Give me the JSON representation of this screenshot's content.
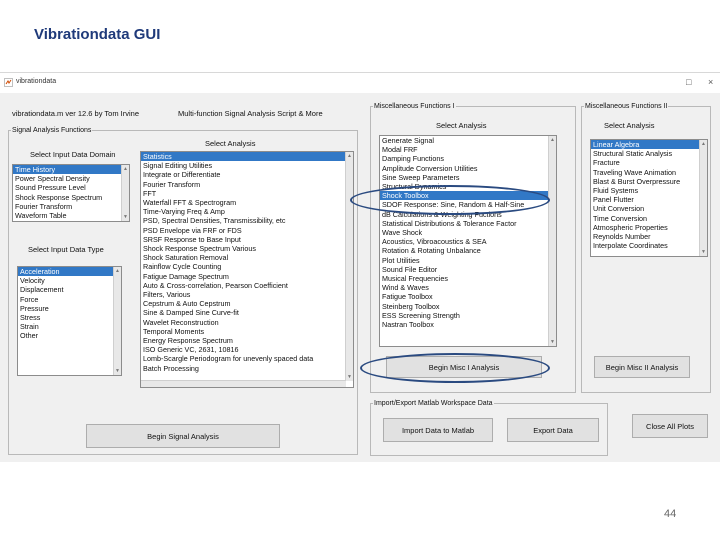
{
  "slide": {
    "title": "Vibrationdata GUI",
    "page_number": "44"
  },
  "window": {
    "title": "vibrationdata",
    "maximize_glyph": "□",
    "close_glyph": "×"
  },
  "header": {
    "version": "vibrationdata.m   ver 12.6   by Tom Irvine",
    "subtitle": "Multi-function Signal Analysis Script & More"
  },
  "signal_panel": {
    "legend": "Signal Analysis Functions",
    "domain_label": "Select Input Data Domain",
    "domain_items": [
      "Time History",
      "Power Spectral Density",
      "Sound Pressure Level",
      "Shock Response Spectrum",
      "Fourier Transform",
      "Waveform Table"
    ],
    "type_label": "Select Input Data Type",
    "type_items": [
      "Acceleration",
      "Velocity",
      "Displacement",
      "Force",
      "Pressure",
      "Stress",
      "Strain",
      "Other"
    ],
    "analysis_label": "Select Analysis",
    "analysis_items": [
      "Statistics",
      "Signal Editing Utilities",
      "Integrate or Differentiate",
      "Fourier Transform",
      "FFT",
      "Waterfall FFT & Spectrogram",
      "Time-Varying Freq & Amp",
      "PSD, Spectral Densities, Transmissibility, etc",
      "PSD Envelope via FRF or FDS",
      "SRSF Response to Base Input",
      "Shock Response Spectrum Various",
      "Shock Saturation Removal",
      "Rainflow Cycle Counting",
      "Fatigue Damage Spectrum",
      "Auto & Cross-correlation, Pearson Coefficient",
      "Filters, Various",
      "Cepstrum & Auto Cepstrum",
      "Sine & Damped Sine Curve-fit",
      "Wavelet Reconstruction",
      "Temporal Moments",
      "Energy Response Spectrum",
      "ISO Generic VC, 2631, 10816",
      "Lomb-Scargle Periodogram for unevenly spaced data",
      "Batch Processing"
    ],
    "begin_button": "Begin Signal Analysis"
  },
  "misc1_panel": {
    "legend": "Miscellaneous Functions I",
    "select_label": "Select Analysis",
    "items": [
      "Generate Signal",
      "Modal FRF",
      "Damping Functions",
      "Amplitude Conversion Utilities",
      "Sine Sweep Parameters",
      "Structural Dynamics",
      "Shock Toolbox",
      "SDOF Response: Sine, Random & Half-Sine",
      "dB Calculations & Weighting Fuctions",
      "Statistical Distributions & Tolerance Factor",
      "Wave Shock",
      "Acoustics, Vibroacoustics & SEA",
      "Rotation & Rotating Unbalance",
      "Plot Utilities",
      "Sound File Editor",
      "Musical Frequencies",
      "Wind & Waves",
      "Fatigue Toolbox",
      "Steinberg Toolbox",
      "ESS Screening Strength",
      "Nastran Toolbox"
    ],
    "selected_index": 6,
    "begin_button": "Begin Misc I Analysis"
  },
  "misc2_panel": {
    "legend": "Miscellaneous Functions II",
    "select_label": "Select Analysis",
    "items": [
      "Linear Algebra",
      "Structural Static Analysis",
      "Fracture",
      "Traveling Wave Animation",
      "Blast & Burst Overpressure",
      "Fluid Systems",
      "Panel Flutter",
      "Unit Conversion",
      "Time Conversion",
      "Atmospheric Properties",
      "Reynolds Number",
      "Interpolate Coordinates"
    ],
    "begin_button": "Begin Misc II Analysis"
  },
  "io_panel": {
    "legend": "Import/Export Matlab Workspace Data",
    "import_button": "Import Data to Matlab",
    "export_button": "Export Data"
  },
  "close_all_button": "Close All Plots",
  "colors": {
    "selection": "#3178c6",
    "title": "#1f3a7a",
    "annotation_oval": "#2a4a80"
  }
}
